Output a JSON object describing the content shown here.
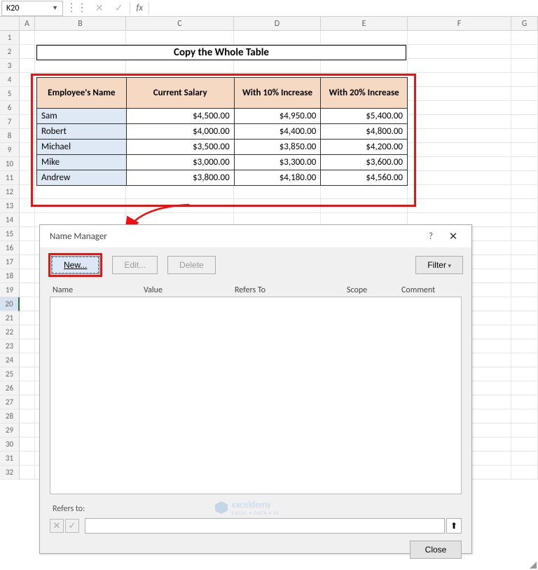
{
  "namebox": {
    "ref": "K20"
  },
  "formula_bar": {
    "cancel_icon": "✕",
    "confirm_icon": "✓",
    "fx": "fx"
  },
  "columns": [
    "A",
    "B",
    "C",
    "D",
    "E",
    "F",
    "G"
  ],
  "rows": [
    "1",
    "2",
    "3",
    "4",
    "5",
    "6",
    "7",
    "8",
    "9",
    "10",
    "11",
    "12",
    "13",
    "14",
    "15",
    "16",
    "17",
    "18",
    "19",
    "20",
    "21",
    "22",
    "23",
    "24",
    "25",
    "26",
    "27",
    "28",
    "29",
    "30",
    "31",
    "32"
  ],
  "active_row": "20",
  "sheet": {
    "title": "Copy the Whole Table",
    "headers": [
      "Employee's Name",
      "Current Salary",
      "With 10% Increase",
      "With 20% Increase"
    ],
    "data": [
      {
        "name": "Sam",
        "salary": "$4,500.00",
        "inc10": "$4,950.00",
        "inc20": "$5,400.00"
      },
      {
        "name": "Robert",
        "salary": "$4,000.00",
        "inc10": "$4,400.00",
        "inc20": "$4,800.00"
      },
      {
        "name": "Michael",
        "salary": "$3,500.00",
        "inc10": "$3,850.00",
        "inc20": "$4,200.00"
      },
      {
        "name": "Mike",
        "salary": "$3,000.00",
        "inc10": "$3,300.00",
        "inc20": "$3,600.00"
      },
      {
        "name": "Andrew",
        "salary": "$3,800.00",
        "inc10": "$4,180.00",
        "inc20": "$4,560.00"
      }
    ]
  },
  "dialog": {
    "title": "Name Manager",
    "help": "?",
    "close": "✕",
    "buttons": {
      "new": "New...",
      "edit": "Edit...",
      "delete": "Delete",
      "filter": "Filter",
      "close_btn": "Close"
    },
    "columns": [
      "Name",
      "Value",
      "Refers To",
      "Scope",
      "Comment"
    ],
    "refers_label": "Refers to:",
    "ref_cancel": "✕",
    "ref_confirm": "✓",
    "ref_collapse": "⬆"
  },
  "watermark": {
    "brand": "exceldemy",
    "tag": "EXCEL • DATA • BI"
  }
}
